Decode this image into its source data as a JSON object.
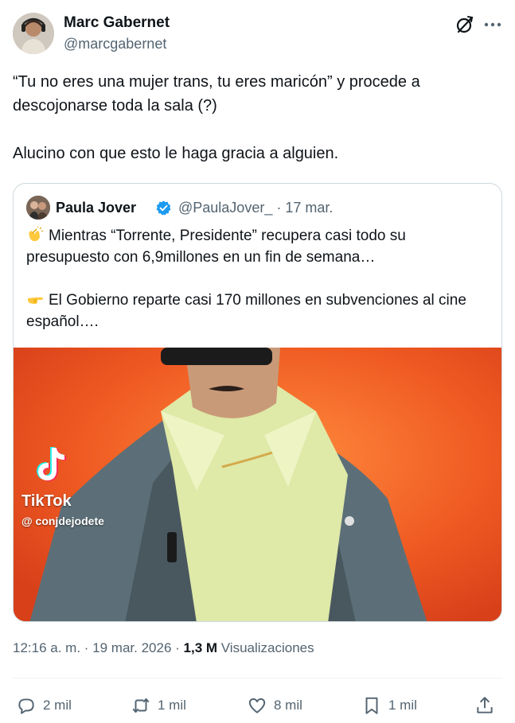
{
  "author": {
    "name": "Marc Gabernet",
    "handle": "@marcgabernet",
    "avatar_icon": "user-photo-avatar"
  },
  "header_icons": {
    "grok": "grok-icon",
    "more": "more-options-icon"
  },
  "tweet": {
    "text_line1": "“Tu no eres una mujer trans, tu eres maricón” y procede a descojonarse toda la sala (?)",
    "text_line2": "Alucino con que esto le haga gracia a alguien."
  },
  "quoted": {
    "name": "Paula Jover",
    "verified_icon": "verified-badge-icon",
    "handle_and_date": "@PaulaJover_ · 17 mar.",
    "paragraph1_emoji": "clapping-hands-emoji",
    "paragraph1": "Mientras “Torrente, Presidente” recupera casi todo su presupuesto con 6,9millones en un fin de semana…",
    "paragraph2_emoji": "pointing-right-emoji",
    "paragraph2": "El Gobierno reparte casi 170 millones en subvenciones al cine español….",
    "media": {
      "watermark_brand": "TikTok",
      "watermark_user": "@ conjdejodete",
      "background_color": "#ef5a22"
    }
  },
  "meta": {
    "time_date": "12:16 a. m. · 19 mar. 2026 · ",
    "views_count": "1,3 M",
    "views_label": " Visualizaciones"
  },
  "actions": {
    "replies": "2 mil",
    "reposts": "1 mil",
    "likes": "8 mil",
    "bookmarks": "1 mil"
  },
  "colors": {
    "text_primary": "#0f1419",
    "text_secondary": "#536471",
    "border": "#cfd9de",
    "verified_blue": "#1d9bf0"
  }
}
